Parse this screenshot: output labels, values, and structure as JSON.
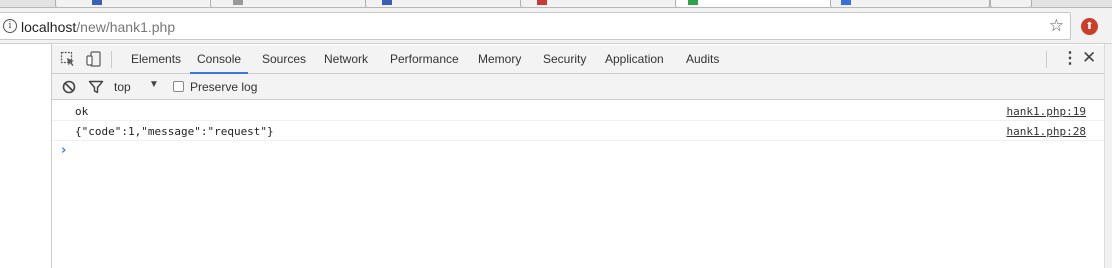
{
  "browser": {
    "url_host": "localhost",
    "url_path": "/new/hank1.php",
    "tab_fav_colors": [
      "#3a5fb5",
      "#777777",
      "#3a5fb5",
      "#c83a3a",
      "#2fa24a",
      "#3a6fd8"
    ]
  },
  "devtools": {
    "tabs": [
      {
        "label": "Elements"
      },
      {
        "label": "Console"
      },
      {
        "label": "Sources"
      },
      {
        "label": "Network"
      },
      {
        "label": "Performance"
      },
      {
        "label": "Memory"
      },
      {
        "label": "Security"
      },
      {
        "label": "Application"
      },
      {
        "label": "Audits"
      }
    ],
    "selected_tab": "Console",
    "accent_color": "#3879d9"
  },
  "console_filter": {
    "context": "top",
    "preserve_log_label": "Preserve log",
    "preserve_log_checked": false
  },
  "messages": [
    {
      "text": "ok",
      "source": "hank1.php:19"
    },
    {
      "text": "{\"code\":1,\"message\":\"request\"}",
      "source": "hank1.php:28"
    }
  ],
  "icons": {
    "info": "info-icon",
    "star": "bookmark-star-icon",
    "extension": "extension-icon",
    "inspect": "inspect-element-icon",
    "device": "device-toolbar-icon",
    "menu": "kebab-menu-icon",
    "close": "close-icon",
    "clear": "clear-console-icon",
    "filter": "filter-icon",
    "prompt": "console-prompt-icon"
  }
}
